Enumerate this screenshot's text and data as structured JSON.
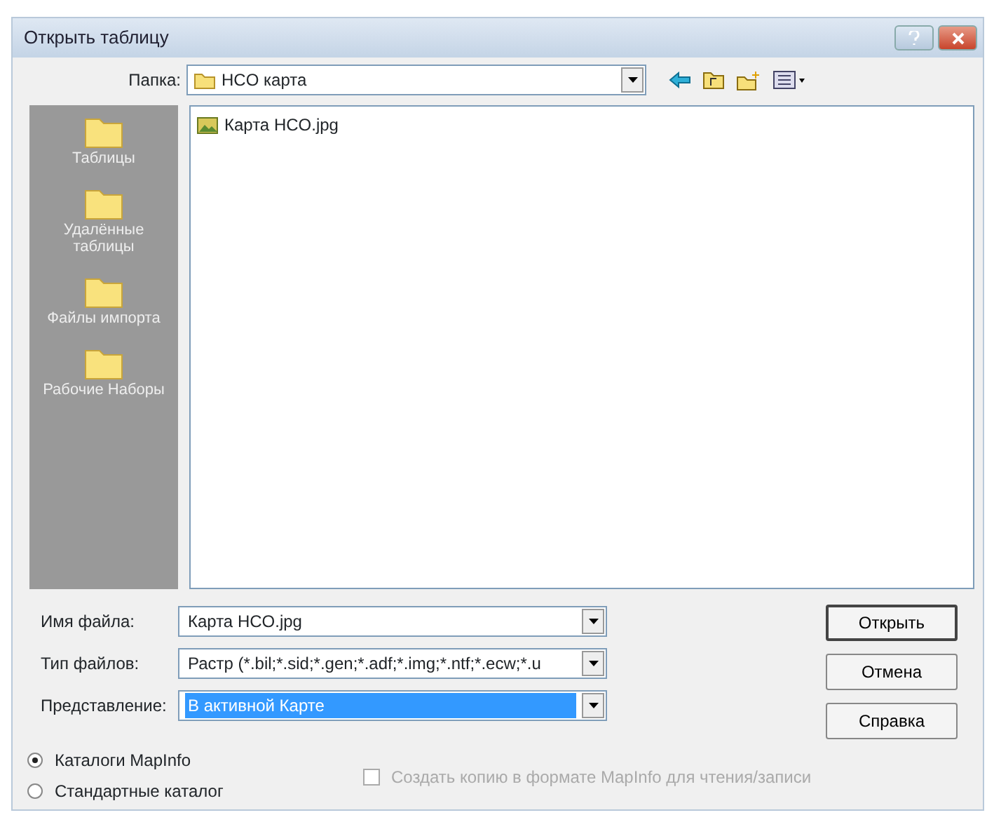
{
  "window": {
    "title": "Открыть таблицу"
  },
  "folder": {
    "label": "Папка:",
    "value": "HCO карта"
  },
  "sidebar": {
    "items": [
      {
        "label": "Таблицы"
      },
      {
        "label": "Удалённые таблицы"
      },
      {
        "label": "Файлы импорта"
      },
      {
        "label": "Рабочие Наборы"
      }
    ]
  },
  "files": [
    {
      "name": "Карта HCO.jpg"
    }
  ],
  "fields": [
    {
      "label": "Имя файла:",
      "value": "Карта HCO.jpg",
      "highlighted": false
    },
    {
      "label": "Тип файлов:",
      "value": "Растр (*.bil;*.sid;*.gen;*.adf;*.img;*.ntf;*.ecw;*.u",
      "highlighted": false
    },
    {
      "label": "Представление:",
      "value": "В активной Карте",
      "highlighted": true
    }
  ],
  "buttons": [
    {
      "label": "Открыть",
      "default": true
    },
    {
      "label": "Отмена",
      "default": false
    },
    {
      "label": "Справка",
      "default": false
    }
  ],
  "catalogs": [
    {
      "label": "Каталоги MapInfo",
      "selected": true
    },
    {
      "label": "Стандартные каталог",
      "selected": false
    }
  ],
  "copy_option": {
    "label": "Создать копию в формате MapInfo для чтения/записи",
    "checked": false,
    "disabled": true
  }
}
